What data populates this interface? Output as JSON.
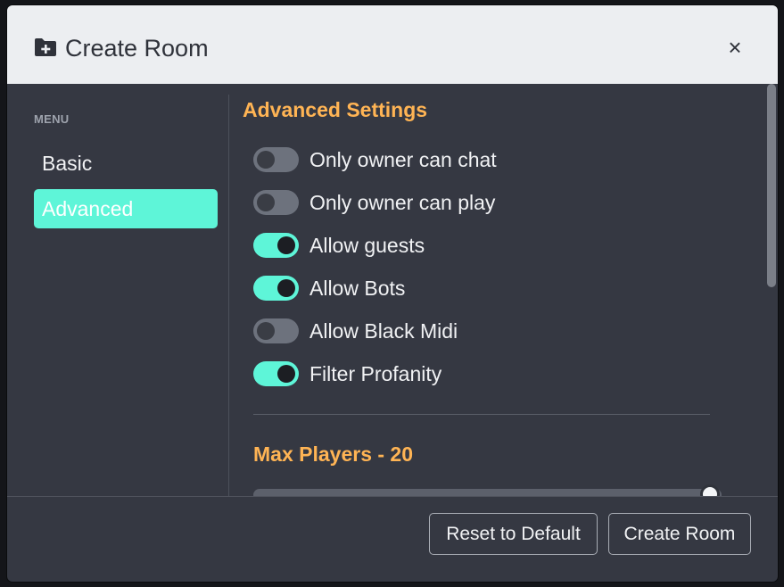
{
  "dialog": {
    "title": "Create Room",
    "header_icon": "folder-plus-icon",
    "close_label": "×"
  },
  "sidebar": {
    "menu_label": "MENU",
    "items": [
      {
        "label": "Basic",
        "active": false
      },
      {
        "label": "Advanced",
        "active": true
      }
    ]
  },
  "advanced": {
    "title": "Advanced Settings",
    "toggles": [
      {
        "label": "Only owner can chat",
        "on": false
      },
      {
        "label": "Only owner can play",
        "on": false
      },
      {
        "label": "Allow guests",
        "on": true
      },
      {
        "label": "Allow Bots",
        "on": true
      },
      {
        "label": "Allow Black Midi",
        "on": false
      },
      {
        "label": "Filter Profanity",
        "on": true
      }
    ]
  },
  "max_players": {
    "label": "Max Players - 20",
    "value": 20,
    "fill_fraction": 1.0
  },
  "footer": {
    "reset_label": "Reset to Default",
    "create_label": "Create Room"
  },
  "colors": {
    "accent": "#5ef5d8",
    "section_title": "#ffb454",
    "modal_bg": "#353842",
    "header_bg": "#eceef1"
  }
}
